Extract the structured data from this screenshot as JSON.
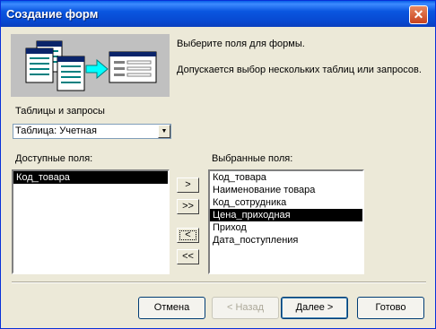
{
  "title": "Создание форм",
  "info_line1": "Выберите поля для формы.",
  "info_line2": "Допускается выбор нескольких таблиц или запросов.",
  "tables_label": "Таблицы и запросы",
  "table_select_value": "Таблица: Учетная",
  "available_label": "Доступные поля:",
  "available_fields": [
    "Код_товара"
  ],
  "selected_label": "Выбранные поля:",
  "selected_fields": [
    "Код_товара",
    "Наименование товара",
    "Код_сотрудника",
    "Цена_приходная",
    "Приход",
    "Дата_поступления"
  ],
  "selected_highlight": "Цена_приходная",
  "move_buttons": {
    "add": ">",
    "add_all": ">>",
    "remove": "<",
    "remove_all": "<<"
  },
  "buttons": {
    "cancel": "Отмена",
    "back": "< Назад",
    "next": "Далее >",
    "finish": "Готово"
  }
}
